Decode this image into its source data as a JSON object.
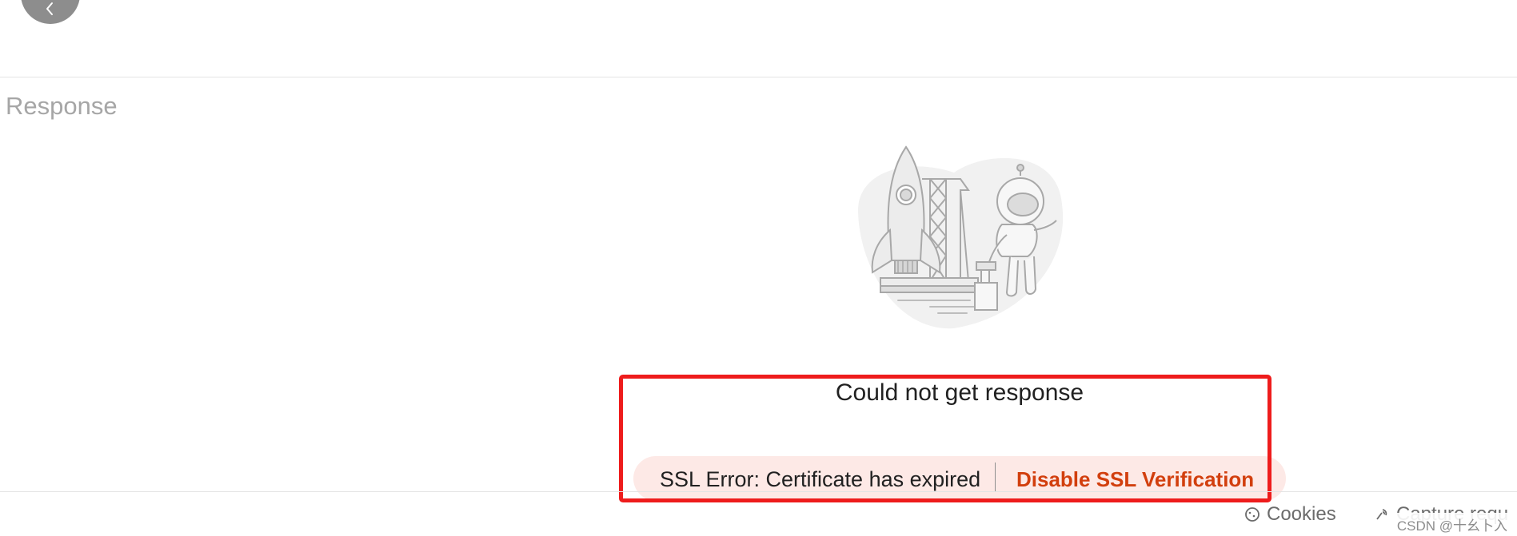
{
  "header": {
    "back_icon": "chevron-left-icon"
  },
  "response": {
    "label": "Response",
    "illustration_icon": "rocket-astronaut-illustration",
    "error_title": "Could not get response",
    "ssl_banner": {
      "message": "SSL Error: Certificate has expired",
      "action_label": "Disable SSL Verification",
      "background_color": "#fde9e6",
      "action_color": "#d23f0e"
    }
  },
  "footer": {
    "cookies_label": "Cookies",
    "cookies_icon": "cookie-icon",
    "capture_label": "Capture requ",
    "capture_icon": "antenna-icon"
  },
  "watermark": {
    "text": "CSDN @十幺卜入"
  },
  "annotation": {
    "highlight_color": "#ee1c1c"
  }
}
